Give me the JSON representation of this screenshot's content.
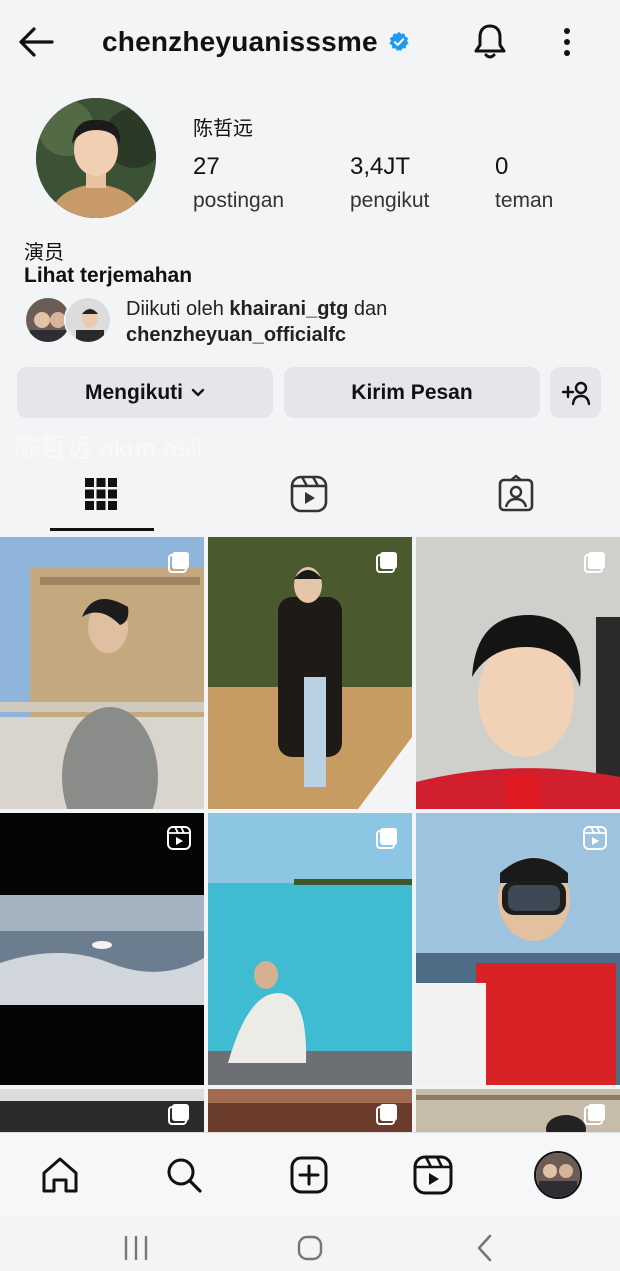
{
  "header": {
    "username": "chenzheyuanisssme",
    "verified_icon": "verified-badge-icon",
    "back_icon": "back-arrow-icon",
    "bell_icon": "bell-icon",
    "more_icon": "more-options-icon"
  },
  "profile": {
    "display_name": "陈哲远",
    "stats": [
      {
        "value": "27",
        "label": "postingan"
      },
      {
        "value": "3,4JT",
        "label": "pengikut"
      },
      {
        "value": "0",
        "label": "teman"
      }
    ],
    "bio": "演员",
    "translate_label": "Lihat terjemahan",
    "followed_by": {
      "prefix": "Diikuti oleh ",
      "user1": "khairani_gtg",
      "connector": " dan",
      "user2": "chenzheyuan_officialfc"
    }
  },
  "actions": {
    "follow_label": "Mengikuti",
    "message_label": "Kirim Pesan"
  },
  "overlay": {
    "text": ": 陈哲远 akun asli"
  },
  "tabs": [
    "grid-icon",
    "reels-icon",
    "tagged-icon"
  ],
  "colors": {
    "verified": "#1d9bf0",
    "background": "#f3f4f6",
    "button": "#e4e6ea"
  },
  "bottom_nav": [
    "home-icon",
    "search-icon",
    "create-icon",
    "reels-icon",
    "profile-avatar"
  ],
  "system_nav": [
    "recent-apps-icon",
    "home-button-icon",
    "back-icon"
  ]
}
